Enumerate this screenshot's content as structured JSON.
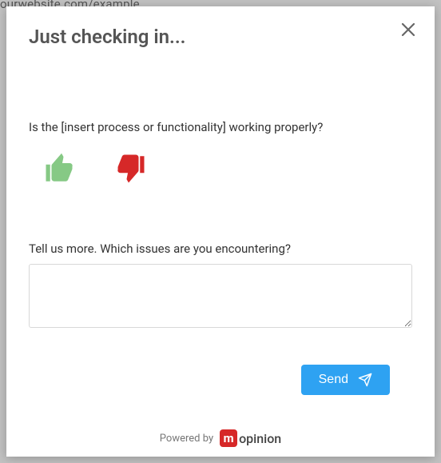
{
  "background_url_fragment": "ourwebsite.com/example",
  "modal": {
    "title": "Just checking in...",
    "question1": "Is the [insert process or functionality] working properly?",
    "question2": "Tell us more. Which issues are you encountering?",
    "textarea_value": "",
    "send_label": "Send",
    "powered_by_prefix": "Powered by",
    "brand_name_rest": "opinion"
  },
  "icons": {
    "close": "close-icon",
    "thumbs_up": "thumbs-up-icon",
    "thumbs_down": "thumbs-down-icon",
    "send": "paper-plane-icon"
  },
  "colors": {
    "thumbs_up": "#86c985",
    "thumbs_down": "#d62828",
    "primary": "#2ea2f2"
  }
}
